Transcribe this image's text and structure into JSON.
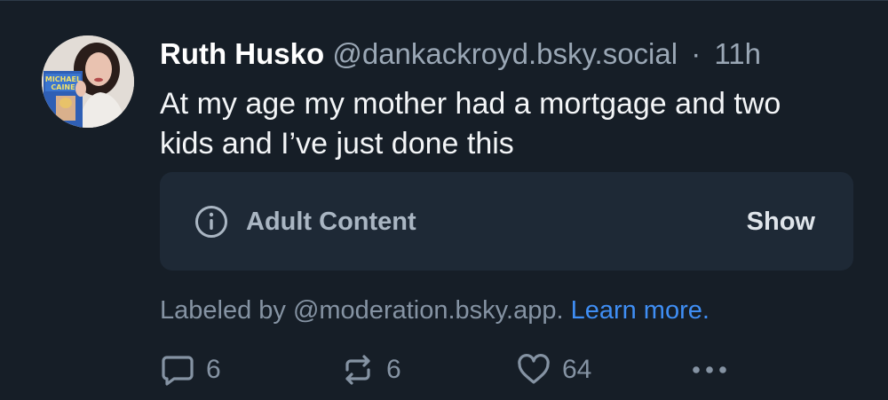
{
  "post": {
    "display_name": "Ruth Husko",
    "handle": "@dankackroyd.bsky.social",
    "separator": "·",
    "time": "11h",
    "text": "At my age my mother had a mortgage and two kids and I’ve just done this"
  },
  "avatar": {
    "icon": "avatar",
    "book_title_line1": "MICHAEL",
    "book_title_line2": "CAINE"
  },
  "content_warning": {
    "icon": "info-icon",
    "label": "Adult Content",
    "show_label": "Show"
  },
  "label_note": {
    "text": "Labeled by @moderation.bsky.app.",
    "link": "Learn more."
  },
  "actions": {
    "reply_count": "6",
    "repost_count": "6",
    "like_count": "64",
    "more_icon": "ellipsis-icon"
  },
  "colors": {
    "background": "#161e27",
    "card": "#1e2936",
    "muted": "#8593a3",
    "link": "#3f8ef4"
  }
}
